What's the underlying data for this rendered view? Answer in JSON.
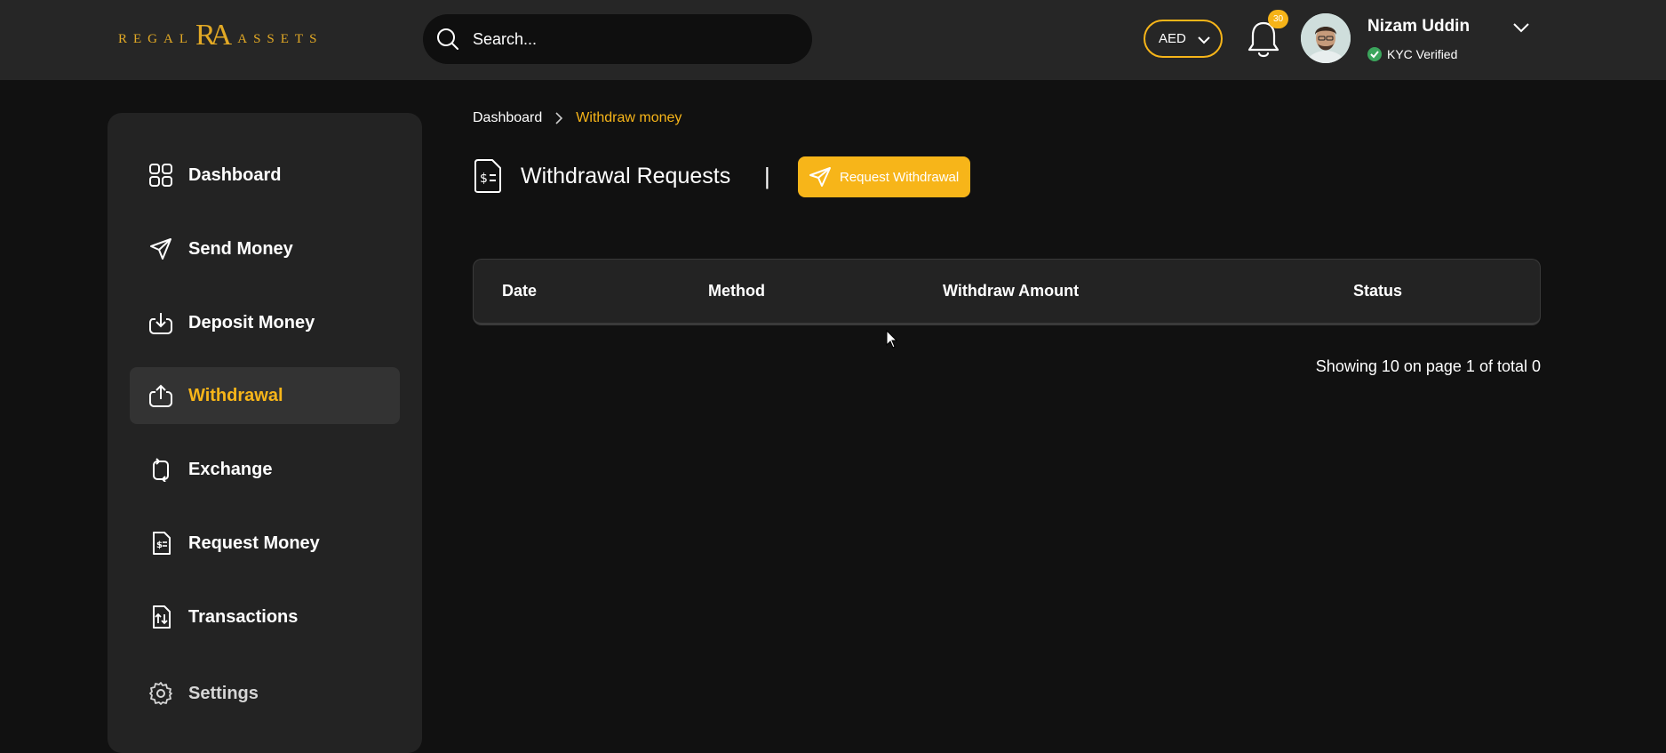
{
  "header": {
    "logo": {
      "left": "REGAL",
      "mono": "RA",
      "right": "ASSETS"
    },
    "search": {
      "placeholder": "Search..."
    },
    "currency": {
      "value": "AED"
    },
    "notifications": {
      "count": "30"
    },
    "user": {
      "name": "Nizam Uddin",
      "status": "KYC Verified"
    }
  },
  "sidebar": {
    "items": [
      {
        "label": "Dashboard",
        "icon": "grid-icon"
      },
      {
        "label": "Send Money",
        "icon": "send-icon"
      },
      {
        "label": "Deposit Money",
        "icon": "deposit-icon"
      },
      {
        "label": "Withdrawal",
        "icon": "withdraw-icon",
        "active": true
      },
      {
        "label": "Exchange",
        "icon": "exchange-icon"
      },
      {
        "label": "Request Money",
        "icon": "request-money-icon"
      },
      {
        "label": "Transactions",
        "icon": "transactions-icon"
      },
      {
        "label": "Settings",
        "icon": "gear-icon"
      }
    ]
  },
  "main": {
    "breadcrumb": {
      "root": "Dashboard",
      "current": "Withdraw money"
    },
    "title": "Withdrawal Requests",
    "divider": "|",
    "request_button": "Request Withdrawal",
    "table": {
      "columns": [
        "Date",
        "Method",
        "Withdraw Amount",
        "Status"
      ],
      "rows": []
    },
    "pagination": "Showing 10 on page 1 of total 0"
  },
  "colors": {
    "accent": "#f7b519",
    "background": "#111111",
    "topbar": "#262626",
    "panel": "#232323"
  }
}
